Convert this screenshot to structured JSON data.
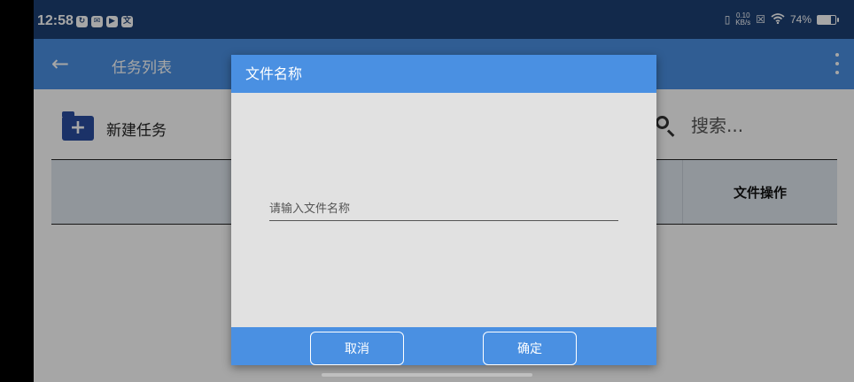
{
  "statusbar": {
    "time": "12:58",
    "icons_left": [
      "sync-icon",
      "mail-icon",
      "play-icon",
      "translate-icon"
    ],
    "netspeed_value": "0.10",
    "netspeed_unit": "KB/s",
    "battery": "74%",
    "battery_level": 0.74
  },
  "appbar": {
    "title": "任务列表"
  },
  "toolbar": {
    "new_task_label": "新建任务",
    "search_placeholder": "搜索..."
  },
  "table": {
    "header_ops": "文件操作"
  },
  "dialog": {
    "title": "文件名称",
    "input_placeholder": "请输入文件名称",
    "input_value": "",
    "cancel_label": "取消",
    "confirm_label": "确定"
  },
  "colors": {
    "primary": "#4a90e2",
    "statusbar": "#1c3f74",
    "folder": "#2a4da0"
  }
}
